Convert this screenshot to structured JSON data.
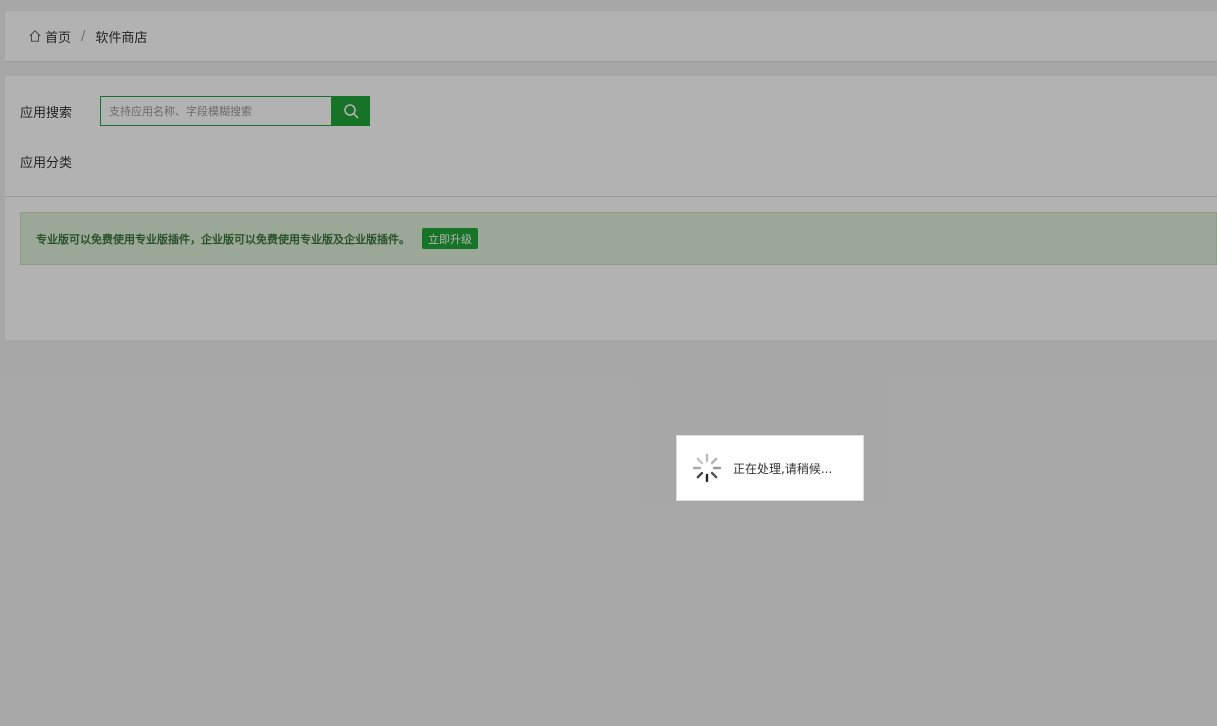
{
  "breadcrumb": {
    "home_label": "首页",
    "separator": "/",
    "current_label": "软件商店"
  },
  "search": {
    "label": "应用搜索",
    "placeholder": "支持应用名称、字段模糊搜索",
    "value": "",
    "button_icon": "search-icon"
  },
  "category": {
    "label": "应用分类"
  },
  "notice": {
    "text": "专业版可以免费使用专业版插件，企业版可以免费使用专业版及企业版插件。",
    "button_label": "立即升级"
  },
  "loading": {
    "icon": "spinner-icon",
    "text": "正在处理,请稍候..."
  },
  "colors": {
    "accent": "#20a53a",
    "notice_bg": "#dff0d8",
    "notice_text": "#3c763d"
  }
}
